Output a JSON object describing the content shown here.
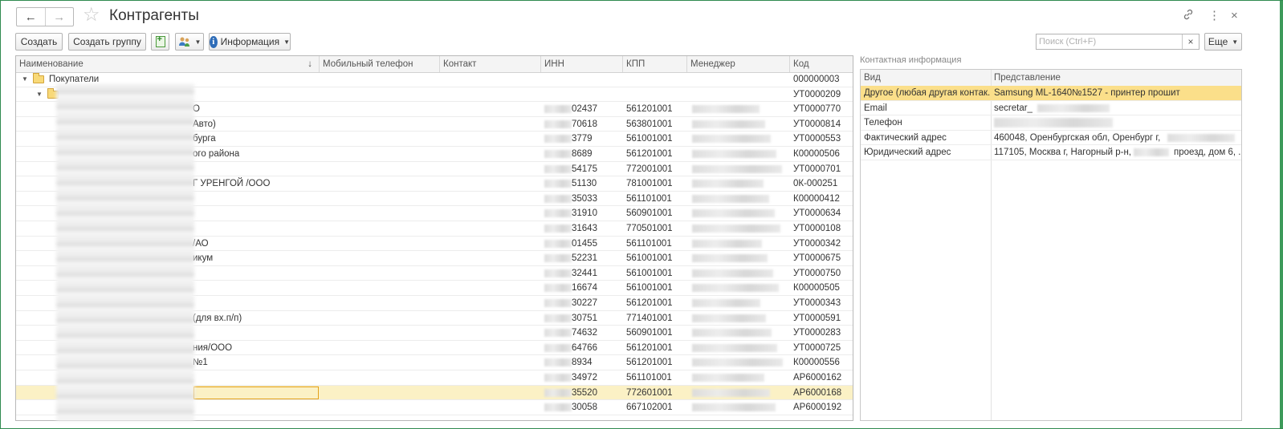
{
  "header": {
    "title": "Контрагенты",
    "back_icon": "←",
    "forward_icon": "→",
    "star_icon": "☆",
    "link_icon": "🔗",
    "more_icon": "⋮",
    "close_icon": "×"
  },
  "toolbar": {
    "create_label": "Создать",
    "create_group_label": "Создать группу",
    "info_label": "Информация",
    "more_label": "Еще"
  },
  "search": {
    "placeholder": "Поиск (Ctrl+F)",
    "value": "",
    "clear": "×"
  },
  "table": {
    "columns": [
      "Наименование",
      "Мобильный телефон",
      "Контакт",
      "ИНН",
      "КПП",
      "Менеджер",
      "Код"
    ],
    "sort_indicator": "↓",
    "group_rows": [
      {
        "name": "Покупатели",
        "code": "000000003"
      },
      {
        "name": "",
        "code": "УТ0000209"
      }
    ],
    "rows": [
      {
        "name_tail": "О",
        "inn_tail": "02437",
        "kpp": "561201001",
        "code": "УТ0000770"
      },
      {
        "name_tail": "Авто)",
        "inn_tail": "70618",
        "kpp": "563801001",
        "code": "УТ0000814"
      },
      {
        "name_tail": "бурга",
        "inn_tail": "3779",
        "kpp": "561001001",
        "code": "УТ0000553"
      },
      {
        "name_tail": "ого района",
        "inn_tail": "8689",
        "kpp": "561201001",
        "code": "К00000506"
      },
      {
        "name_tail": "",
        "inn_tail": "54175",
        "kpp": "772001001",
        "code": "УТ0000701"
      },
      {
        "name_tail": "Г УРЕНГОЙ /ООО",
        "inn_tail": "51130",
        "kpp": "781001001",
        "code": "0К-000251"
      },
      {
        "name_tail": "",
        "inn_tail": "35033",
        "kpp": "561101001",
        "code": "К00000412"
      },
      {
        "name_tail": "",
        "inn_tail": "31910",
        "kpp": "560901001",
        "code": "УТ0000634"
      },
      {
        "name_tail": "",
        "inn_tail": "31643",
        "kpp": "770501001",
        "code": "УТ0000108"
      },
      {
        "name_tail": "/АО",
        "inn_tail": "01455",
        "kpp": "561101001",
        "code": "УТ0000342"
      },
      {
        "name_tail": "икум",
        "inn_tail": "52231",
        "kpp": "561001001",
        "code": "УТ0000675"
      },
      {
        "name_tail": "",
        "inn_tail": "32441",
        "kpp": "561001001",
        "code": "УТ0000750"
      },
      {
        "name_tail": "",
        "inn_tail": "16674",
        "kpp": "561001001",
        "code": "К00000505"
      },
      {
        "name_tail": "",
        "inn_tail": "30227",
        "kpp": "561201001",
        "code": "УТ0000343"
      },
      {
        "name_tail": "(для вх.п/п)",
        "inn_tail": "30751",
        "kpp": "771401001",
        "code": "УТ0000591"
      },
      {
        "name_tail": "",
        "inn_tail": "74632",
        "kpp": "560901001",
        "code": "УТ0000283"
      },
      {
        "name_tail": "ния/ООО",
        "inn_tail": "64766",
        "kpp": "561201001",
        "code": "УТ0000725"
      },
      {
        "name_tail": "№1",
        "inn_tail": "8934",
        "kpp": "561201001",
        "code": "К00000556"
      },
      {
        "name_tail": "",
        "inn_tail": "34972",
        "kpp": "561101001",
        "code": "АР6000162"
      },
      {
        "name_tail": "",
        "inn_tail": "35520",
        "kpp": "772601001",
        "code": "АР6000168"
      },
      {
        "name_tail": "",
        "inn_tail": "30058",
        "kpp": "667102001",
        "code": "АР6000192"
      }
    ]
  },
  "contact_info": {
    "title": "Контактная информация",
    "columns": [
      "Вид",
      "Представление"
    ],
    "rows": [
      {
        "kind": "Другое (любая другая контак...",
        "value": "Samsung ML-1640№1527 - принтер прошит"
      },
      {
        "kind": "Email",
        "value": "secretar_"
      },
      {
        "kind": "Телефон",
        "value": ""
      },
      {
        "kind": "Фактический адрес",
        "value": "460048, Оренбургская обл, Оренбург г,"
      },
      {
        "kind": "Юридический адрес",
        "value": "117105, Москва г, Нагорный р-н,"
      },
      {
        "kind": "",
        "value": "проезд, дом 6, ..."
      }
    ]
  },
  "colors": {
    "selection": "#fbf1c5",
    "selection_strong": "#fbdf8a",
    "accent": "#2f6db8",
    "frame": "#2f8a4f"
  }
}
